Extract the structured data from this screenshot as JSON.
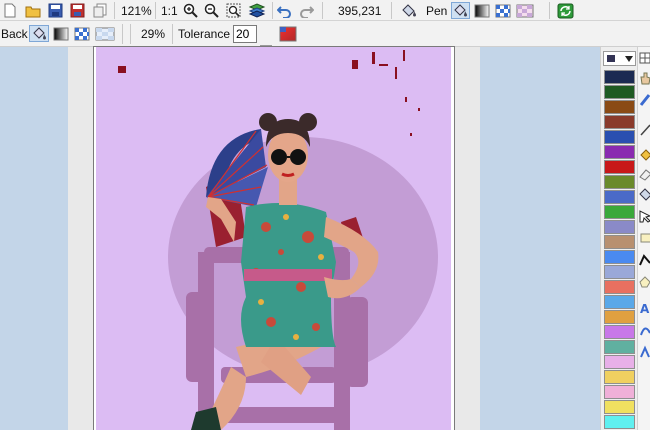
{
  "toolbar": {
    "zoom_value": "121%",
    "actual_size_label": "1:1",
    "cursor_coords": "395,231",
    "pen_label": "Pen"
  },
  "fill_toolbar": {
    "back_label": "Back",
    "opacity_value": "29%",
    "tolerance_label": "Tolerance",
    "tolerance_value": "20"
  },
  "palette": {
    "colors": [
      "#1b2a52",
      "#1f5a22",
      "#8a4a14",
      "#8a3a2a",
      "#2a4fb0",
      "#8a2ab0",
      "#c81818",
      "#6a8a2a",
      "#4a6ac8",
      "#3aa83a",
      "#8a8ac8",
      "#b89070",
      "#4a8af0",
      "#9aa8d8",
      "#e87060",
      "#5aa8e8",
      "#e0a040",
      "#c878e8",
      "#60b0a0",
      "#e8b0e8",
      "#f0d060",
      "#f0b0d8",
      "#f0e060",
      "#60f0f0",
      "#f0f090"
    ]
  },
  "icons": {
    "new": "new-file-icon",
    "open": "open-folder-icon",
    "save": "save-icon",
    "save_all": "save-all-icon",
    "copy": "copy-icon"
  },
  "colors": {
    "canvas_bg": "#dcbcf3",
    "workspace_bg": "#c3d5e8",
    "fill_color": "#e04020"
  }
}
